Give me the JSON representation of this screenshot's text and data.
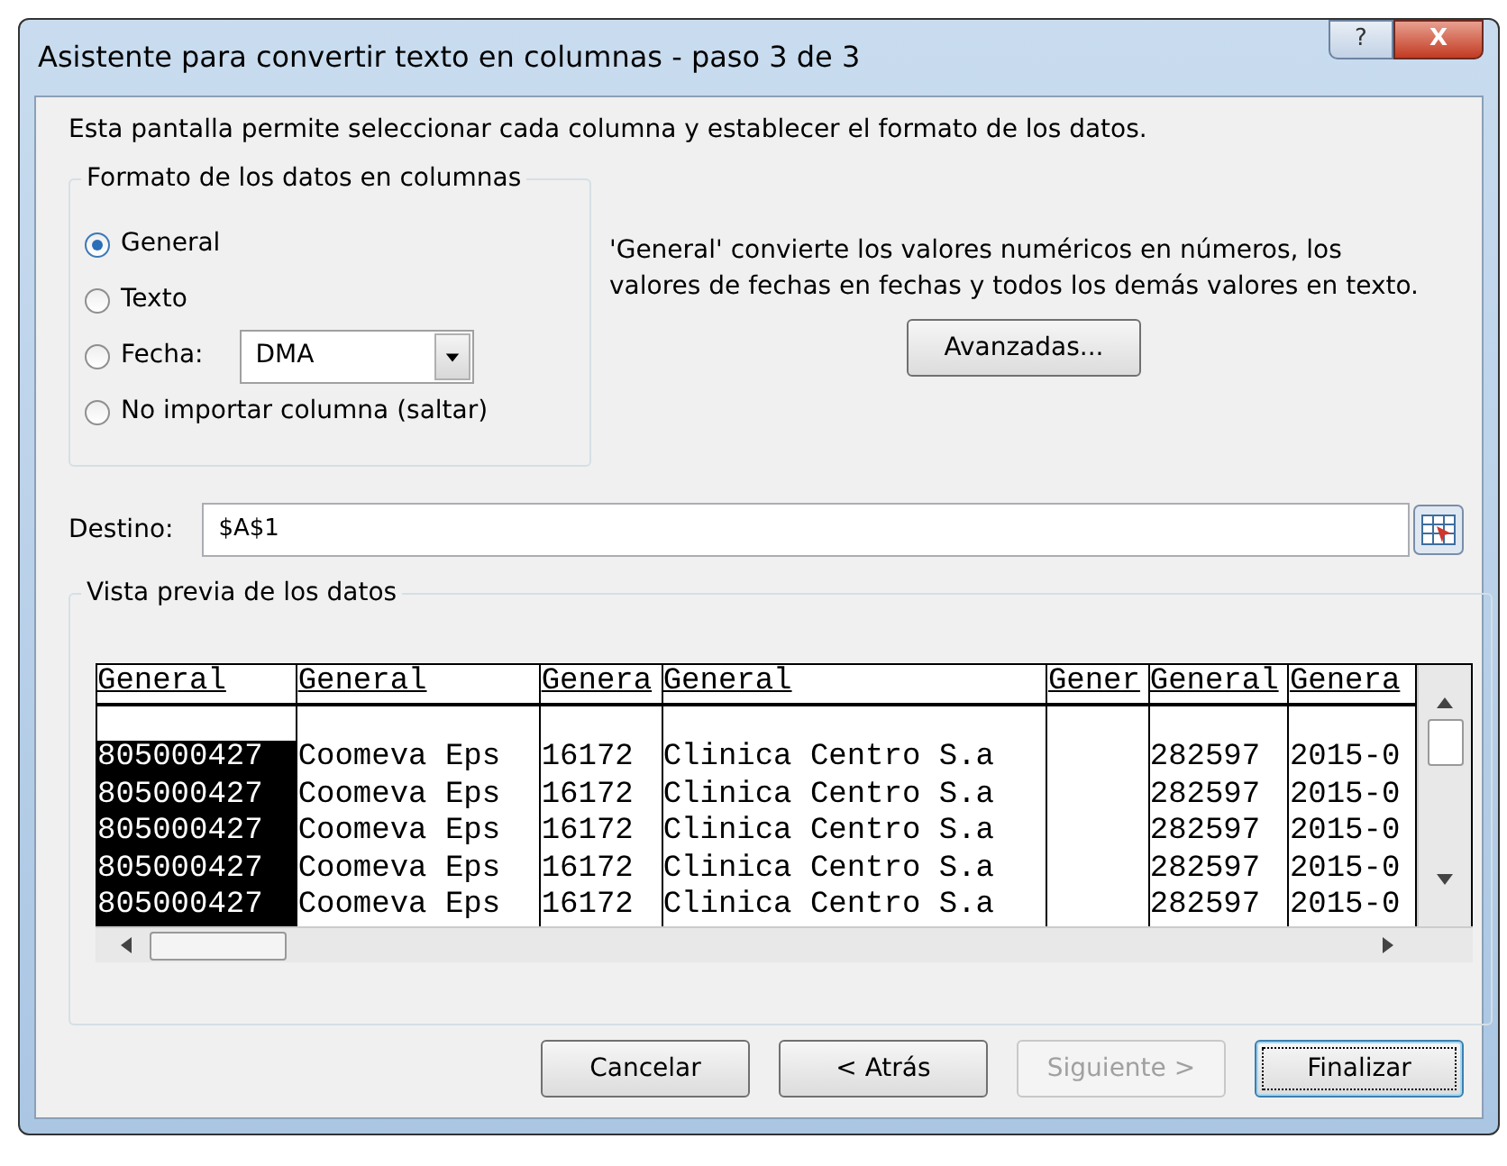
{
  "window": {
    "title": "Asistente para convertir texto en columnas - paso 3 de 3",
    "help_button": "?",
    "close_button": "X"
  },
  "intro": "Esta pantalla permite seleccionar cada columna y establecer el formato de los datos.",
  "format_group": {
    "legend": "Formato de los datos en columnas",
    "options": [
      {
        "kind": "plain",
        "label": "General",
        "selected": true
      },
      {
        "kind": "plain",
        "label": "Texto",
        "selected": false
      },
      {
        "kind": "date",
        "label": "Fecha:",
        "selected": false,
        "value": "DMA"
      },
      {
        "kind": "plain",
        "label": "No importar columna (saltar)",
        "selected": false
      }
    ]
  },
  "explanation": "'General' convierte los valores numéricos en números, los valores de fechas en fechas y todos los demás valores en texto.",
  "advanced_button": "Avanzadas...",
  "destination": {
    "label": "Destino:",
    "value": "$A$1"
  },
  "preview": {
    "legend": "Vista previa de los datos",
    "columns": [
      {
        "header": "General",
        "selected": true
      },
      {
        "header": "General",
        "selected": false
      },
      {
        "header": "Genera",
        "selected": false
      },
      {
        "header": "General",
        "selected": false
      },
      {
        "header": "Gener",
        "selected": false
      },
      {
        "header": "General",
        "selected": false
      },
      {
        "header": "Genera",
        "selected": false
      }
    ],
    "rows": [
      [
        "805000427",
        "Coomeva Eps",
        "16172",
        "Clinica Centro S.a",
        "",
        "282597",
        "2015-0"
      ],
      [
        "805000427",
        "Coomeva Eps",
        "16172",
        "Clinica Centro S.a",
        "",
        "282597",
        "2015-0"
      ],
      [
        "805000427",
        "Coomeva Eps",
        "16172",
        "Clinica Centro S.a",
        "",
        "282597",
        "2015-0"
      ],
      [
        "805000427",
        "Coomeva Eps",
        "16172",
        "Clinica Centro S.a",
        "",
        "282597",
        "2015-0"
      ],
      [
        "805000427",
        "Coomeva Eps",
        "16172",
        "Clinica Centro S.a",
        "",
        "282597",
        "2015-0"
      ]
    ]
  },
  "buttons": [
    {
      "kind": "normal",
      "label": "Cancelar",
      "disabled": false
    },
    {
      "kind": "normal",
      "label": "< Atrás",
      "disabled": false
    },
    {
      "kind": "normal",
      "label": "Siguiente >",
      "disabled": true
    },
    {
      "kind": "default",
      "label": "Finalizar",
      "disabled": false
    }
  ]
}
